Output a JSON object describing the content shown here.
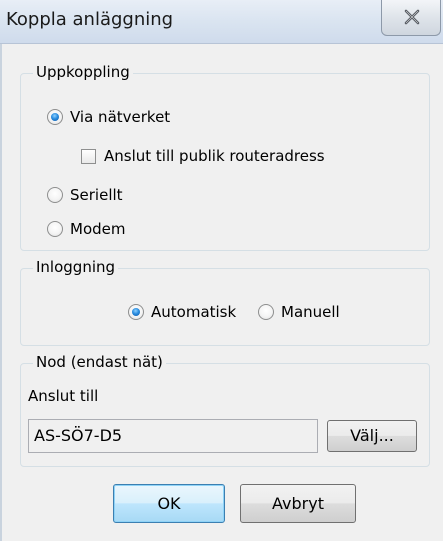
{
  "window": {
    "title": "Koppla anläggning",
    "close_icon": "close-x"
  },
  "connection": {
    "legend": "Uppkoppling",
    "options": [
      {
        "label": "Via nätverket",
        "checked": true
      },
      {
        "label": "Seriellt",
        "checked": false
      },
      {
        "label": "Modem",
        "checked": false
      }
    ],
    "public_router": {
      "label": "Anslut till publik routeradress",
      "checked": false
    }
  },
  "login": {
    "legend": "Inloggning",
    "options": [
      {
        "label": "Automatisk",
        "checked": true
      },
      {
        "label": "Manuell",
        "checked": false
      }
    ]
  },
  "node": {
    "legend": "Nod (endast nät)",
    "connect_label": "Anslut till",
    "value": "AS-SÖ7-D5",
    "choose_label": "Välj..."
  },
  "buttons": {
    "ok": "OK",
    "cancel": "Avbryt"
  }
}
